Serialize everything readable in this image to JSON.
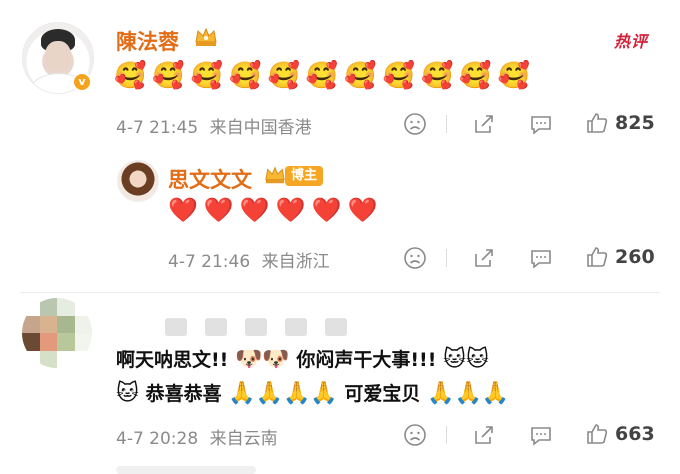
{
  "post_badge": "热评",
  "comments": [
    {
      "username": "陳法蓉",
      "verified_mark": "v",
      "content_emojis": [
        "🥰",
        "🥰",
        "🥰",
        "🥰",
        "🥰",
        "🥰",
        "🥰",
        "🥰",
        "🥰",
        "🥰",
        "🥰"
      ],
      "timestamp": "4-7 21:45",
      "location": "来自中国香港",
      "like_count": "825"
    }
  ],
  "reply": {
    "username": "思文文文",
    "author_tag": "博主",
    "content_emojis": [
      "❤️",
      "❤️",
      "❤️",
      "❤️",
      "❤️",
      "❤️"
    ],
    "timestamp": "4-7 21:46",
    "location": "来自浙江",
    "like_count": "260"
  },
  "comment3": {
    "text_part1": "啊天呐思文!!",
    "emoji_part1": "🐶🐶",
    "text_part2": "你闷声干大事!!!",
    "emoji_part2": "🐱🐱",
    "emoji_part3": "🐱",
    "text_part3": "恭喜恭喜",
    "emoji_part4": "🙏🙏🙏🙏",
    "text_part4": "可爱宝贝",
    "emoji_part5": "🙏🙏🙏",
    "timestamp": "4-7 20:28",
    "location": "来自云南",
    "like_count": "663"
  },
  "icons": {
    "dislike": "frown-face-icon",
    "share": "share-icon",
    "reply": "comment-bubble-icon",
    "like": "thumbs-up-icon"
  },
  "colors": {
    "username": "#e36d17",
    "meta_gray": "#8a8a8a",
    "hot_red": "#d3233a",
    "author_tag_bg": "#f5a623"
  }
}
